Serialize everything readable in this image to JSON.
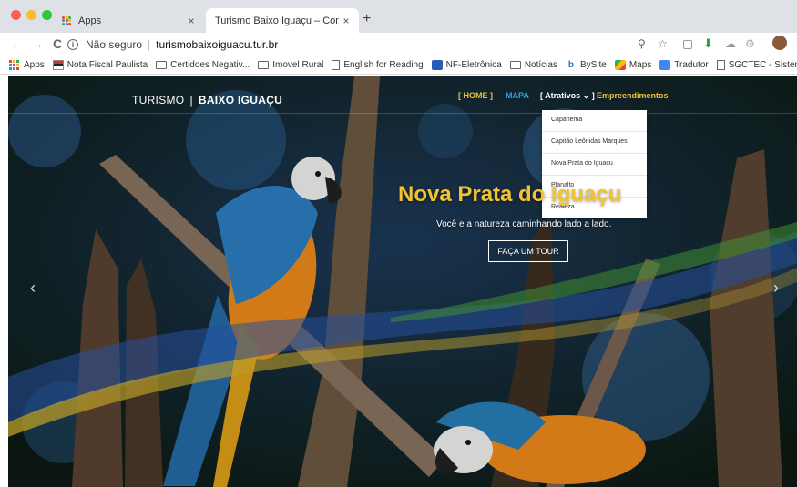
{
  "browser": {
    "tabs": [
      {
        "title": "Apps",
        "close": "×"
      },
      {
        "title": "Turismo Baixo Iguaçu – Conhe",
        "close": "×"
      }
    ],
    "new_tab": "+",
    "nav": {
      "back": "←",
      "forward": "→",
      "reload": "C"
    },
    "address": {
      "info": "i",
      "security": "Não seguro",
      "url": "turismobaixoiguacu.tur.br"
    }
  },
  "bookmarks": [
    {
      "label": "Apps",
      "icon": "apps-grid-icon"
    },
    {
      "label": "Nota Fiscal Paulista",
      "icon": "flag-icon"
    },
    {
      "label": "Certidoes Negativ...",
      "icon": "folder-icon"
    },
    {
      "label": "Imovel Rural",
      "icon": "folder-icon"
    },
    {
      "label": "English for Reading",
      "icon": "document-icon"
    },
    {
      "label": "NF-Eletrônica",
      "icon": "nfe-icon"
    },
    {
      "label": "Notícias",
      "icon": "folder-icon"
    },
    {
      "label": "BySite",
      "icon": "bysite-icon"
    },
    {
      "label": "Maps",
      "icon": "maps-icon"
    },
    {
      "label": "Tradutor",
      "icon": "translate-icon"
    },
    {
      "label": "SGCTEC - Sistem...",
      "icon": "document-icon"
    }
  ],
  "site": {
    "brand": {
      "part1": "TURISMO",
      "separator": "|",
      "part2": "BAIXO IGUAÇU"
    },
    "menu": {
      "home": "[ HOME ]",
      "mapa": "MAPA",
      "atrativos": "[ Atrativos ⌄ ]",
      "empreendimentos": "Empreendimentos"
    },
    "dropdown": [
      "Capanema",
      "Capitão Leônidas Marques",
      "Nova Prata do Iguaçu",
      "Planalto",
      "Realeza"
    ],
    "hero": {
      "title": "Nova Prata do Iguaçu",
      "subtitle": "Você e a natureza caminhando lado a lado.",
      "button": "FAÇA UM TOUR"
    },
    "slider": {
      "prev": "‹",
      "next": "›"
    }
  },
  "colors": {
    "accent_yellow": "#f2c230",
    "accent_blue": "#2aa7e0",
    "tab_bar": "#dee1e6"
  }
}
